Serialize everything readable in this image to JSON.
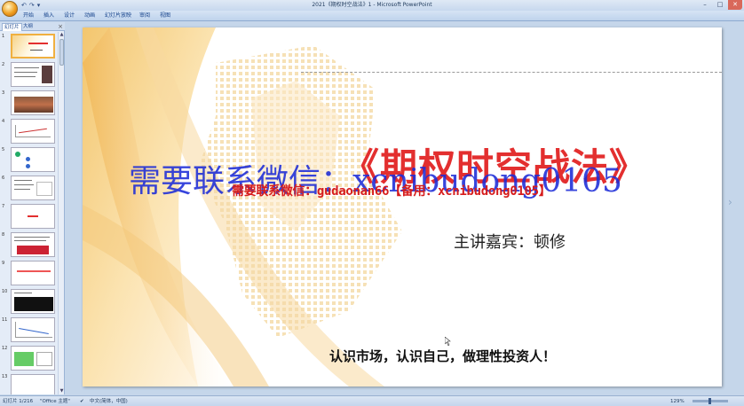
{
  "window": {
    "title": "2021《期权时空战法》1 - Microsoft PowerPoint",
    "controls": [
      "–",
      "□",
      "✕"
    ]
  },
  "quick_access": [
    "↶",
    "↷",
    "▾"
  ],
  "ribbon_tabs": [
    "开始",
    "插入",
    "设计",
    "动画",
    "幻灯片放映",
    "审阅",
    "视图"
  ],
  "pane": {
    "tabs": [
      "幻灯片",
      "大纲"
    ],
    "close_glyph": "×",
    "slide_numbers": [
      "1",
      "2",
      "3",
      "4",
      "5",
      "6",
      "7",
      "8",
      "9",
      "10",
      "11",
      "12",
      "13"
    ]
  },
  "slide": {
    "title": "《期权时空战法》",
    "overlay_blue": "需要联系微信：xcnibudong0105",
    "overlay_red": "需要联系微信：gudaonan66【备用：xcnibudong0105】",
    "presenter": "主讲嘉宾：顿修",
    "slogan": "认识市场，认识自己，做理性投资人！"
  },
  "statusbar": {
    "slide_count": "幻灯片 1/216",
    "theme": "\"Office 主题\"",
    "language": "中文(简体，中国)",
    "zoom": "129%"
  },
  "colors": {
    "title_red": "#e32f2f",
    "overlay_blue": "#1c2cd8",
    "ribbon_blue": "#15428b"
  }
}
